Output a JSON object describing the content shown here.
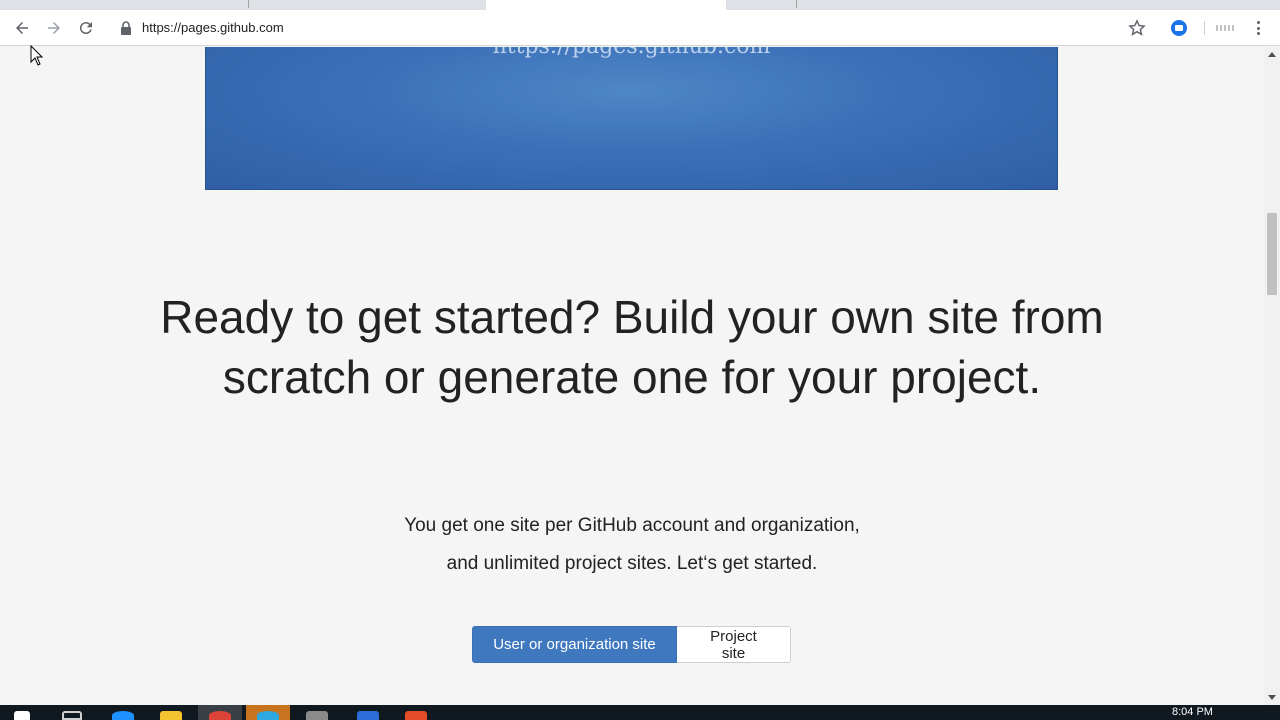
{
  "browser": {
    "url": "https://pages.github.com",
    "icons": {
      "back": "back-arrow-icon",
      "forward": "forward-arrow-icon",
      "reload": "reload-icon",
      "lock": "lock-icon",
      "bookmark": "star-icon",
      "menu": "vertical-dots-icon"
    }
  },
  "hero": {
    "banner_text": "https://pages.github.com"
  },
  "main": {
    "headline": "Ready to get started? Build your own site from scratch or generate one for your project.",
    "subtext_line1": "You get one site per GitHub account and organization,",
    "subtext_line2": "and unlimited project sites. Let‘s get started.",
    "buttons": {
      "primary": "User or organization site",
      "secondary": "Project site"
    }
  },
  "taskbar": {
    "clock": "8:04 PM"
  },
  "colors": {
    "accent": "#4078c0",
    "banner": "#3b70b8",
    "background": "#f5f5f5",
    "text": "#222222"
  }
}
